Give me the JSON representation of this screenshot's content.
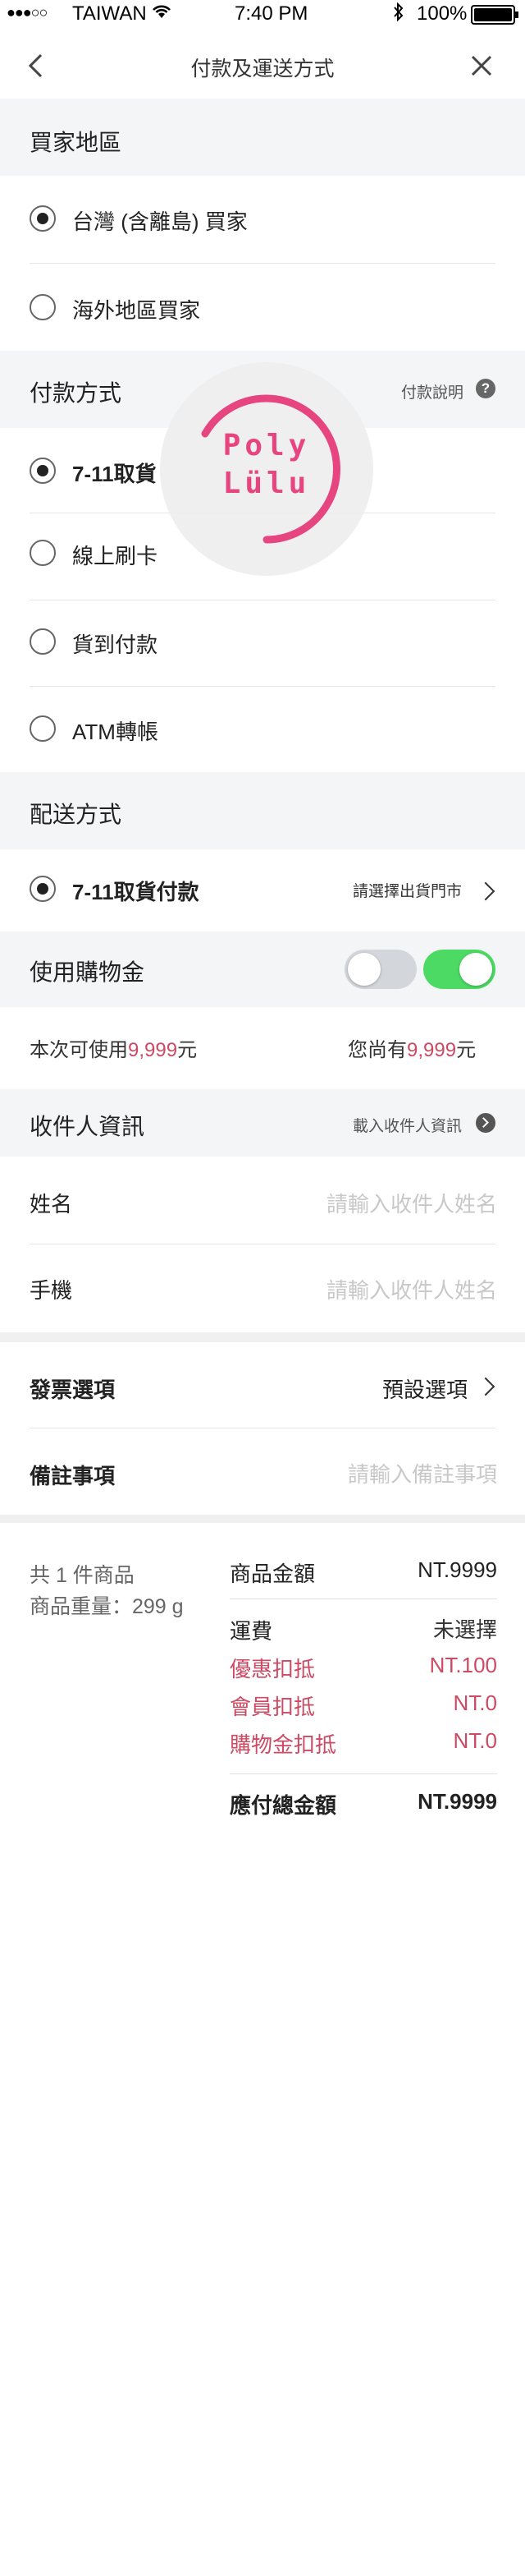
{
  "status": {
    "carrier": "TAIWAN",
    "time": "7:40 PM",
    "battery": "100%"
  },
  "header": {
    "title": "付款及運送方式"
  },
  "buyer_region": {
    "title": "買家地區",
    "options": [
      "台灣 (含離島) 買家",
      "海外地區買家"
    ],
    "selected": 0
  },
  "payment": {
    "title": "付款方式",
    "help_label": "付款說明",
    "options": [
      "7-11取貨",
      "線上刷卡",
      "貨到付款",
      "ATM轉帳"
    ],
    "selected": 0
  },
  "watermark": {
    "line1": "Poly",
    "line2": "Lülu",
    "color": "#e6457f"
  },
  "shipping": {
    "title": "配送方式",
    "option": "7-11取貨付款",
    "action": "請選擇出貨門市"
  },
  "credit": {
    "title": "使用購物金",
    "toggle_off": false,
    "toggle_on": true,
    "available_prefix": "本次可使用",
    "available_value": "9,999",
    "available_suffix": "元",
    "owned_prefix": "您尚有",
    "owned_value": "9,999",
    "owned_suffix": "元"
  },
  "recipient": {
    "title": "收件人資訊",
    "load_label": "載入收件人資訊",
    "name_label": "姓名",
    "name_placeholder": "請輸入收件人姓名",
    "phone_label": "手機",
    "phone_placeholder": "請輸入收件人姓名"
  },
  "invoice": {
    "label": "發票選項",
    "value": "預設選項"
  },
  "note": {
    "label": "備註事項",
    "placeholder": "請輸入備註事項"
  },
  "summary": {
    "count_text": "共 1 件商品",
    "weight_text": "商品重量：299 g",
    "rows": [
      {
        "label": "商品金額",
        "value": "NT.9999"
      },
      {
        "label": "運費",
        "value": "未選擇"
      },
      {
        "label": "優惠扣抵",
        "value": "NT.100"
      },
      {
        "label": "會員扣抵",
        "value": "NT.0"
      },
      {
        "label": "購物金扣抵",
        "value": "NT.0"
      }
    ],
    "total_label": "應付總金額",
    "total_value": "NT.9999"
  },
  "colors": {
    "accent_pink": "#cc4a63",
    "toggle_green": "#4cd964"
  }
}
